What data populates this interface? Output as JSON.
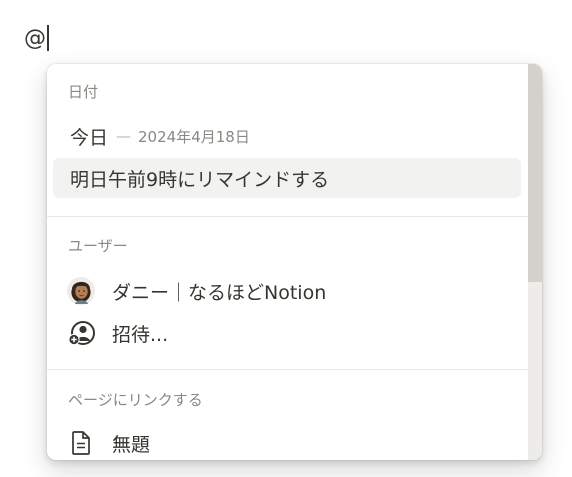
{
  "editor": {
    "typed_text": "@"
  },
  "mention_menu": {
    "date_section": {
      "header": "日付",
      "items": [
        {
          "label": "今日",
          "dash": "—",
          "hint": "2024年4月18日"
        },
        {
          "label": "明日午前9時にリマインドする"
        }
      ]
    },
    "user_section": {
      "header": "ユーザー",
      "items": [
        {
          "label": "ダニー｜なるほどNotion",
          "icon": "user-avatar-icon"
        },
        {
          "label": "招待...",
          "icon": "invite-user-icon"
        }
      ]
    },
    "page_section": {
      "header": "ページにリンクする",
      "items": [
        {
          "label": "無題",
          "icon": "document-icon"
        }
      ]
    }
  },
  "colors": {
    "text": "#37352f",
    "muted": "#8a8883",
    "hover_bg": "#f2f2f1",
    "scroll_thumb": "#d3d1cb",
    "scroll_track": "#edece9"
  }
}
